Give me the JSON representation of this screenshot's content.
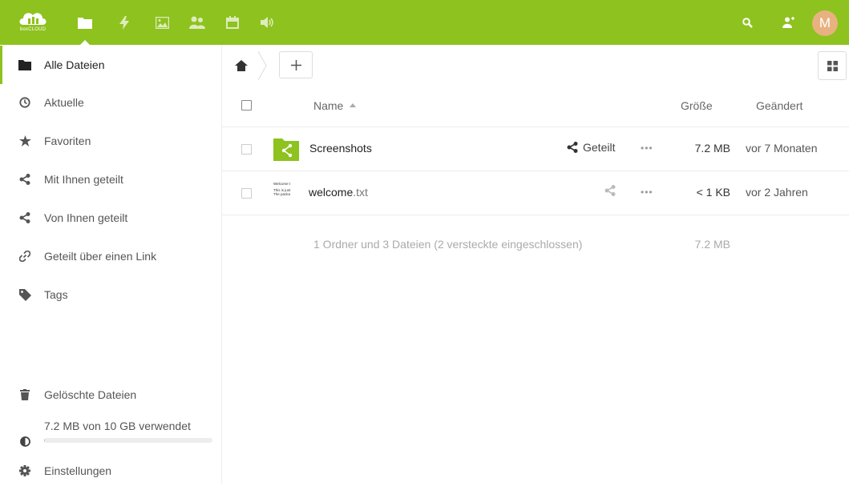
{
  "header": {
    "logo_text": "boxCLOUD",
    "apps": [
      {
        "icon": "folder-icon",
        "label": "Dateien"
      },
      {
        "icon": "activity-icon",
        "label": "Aktivität"
      },
      {
        "icon": "image-icon",
        "label": "Galerie"
      },
      {
        "icon": "contacts-icon",
        "label": "Kontakte"
      },
      {
        "icon": "calendar-icon",
        "label": "Kalender"
      },
      {
        "icon": "audio-icon",
        "label": "Audio"
      }
    ],
    "avatar_letter": "M",
    "accent_color": "#8ec21f",
    "avatar_color": "#e7b27f"
  },
  "sidebar": {
    "items": [
      {
        "label": "Alle Dateien",
        "icon": "folder-icon",
        "active": true
      },
      {
        "label": "Aktuelle",
        "icon": "clock-icon"
      },
      {
        "label": "Favoriten",
        "icon": "star-icon"
      },
      {
        "label": "Mit Ihnen geteilt",
        "icon": "share-icon"
      },
      {
        "label": "Von Ihnen geteilt",
        "icon": "share-icon"
      },
      {
        "label": "Geteilt über einen Link",
        "icon": "link-icon"
      },
      {
        "label": "Tags",
        "icon": "tag-icon"
      }
    ],
    "deleted": "Gelöschte Dateien",
    "quota": "7.2 MB von 10 GB verwendet",
    "quota_fraction": 0.0007,
    "settings": "Einstellungen"
  },
  "table": {
    "headers": {
      "name": "Name",
      "size": "Größe",
      "modified": "Geändert"
    },
    "rows": [
      {
        "name": "Screenshots",
        "ext": "",
        "share_label": "Geteilt",
        "size": "7.2 MB",
        "modified": "vor 7 Monaten",
        "type": "shared-folder"
      },
      {
        "name": "welcome",
        "ext": ".txt",
        "share_label": "",
        "size": "< 1 KB",
        "modified": "vor 2 Jahren",
        "type": "text-file",
        "preview_lines": [
          "Welcome t",
          "This is just",
          "The packa"
        ]
      }
    ],
    "summary": "1 Ordner und 3 Dateien (2 versteckte eingeschlossen)",
    "summary_size": "7.2 MB"
  }
}
